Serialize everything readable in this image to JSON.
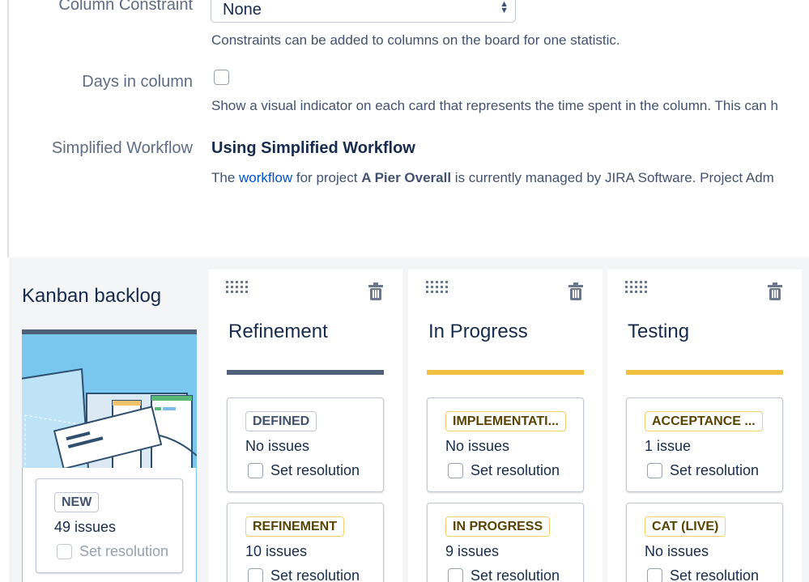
{
  "settings": {
    "column_constraint": {
      "label": "Column Constraint",
      "value": "None",
      "description": "Constraints can be added to columns on the board for one statistic."
    },
    "days_in_column": {
      "label": "Days in column",
      "checked": false,
      "description": "Show a visual indicator on each card that represents the time spent in the column. This can h"
    },
    "simplified_workflow": {
      "label": "Simplified Workflow",
      "heading": "Using Simplified Workflow",
      "desc_prefix": "The ",
      "desc_link": "workflow",
      "desc_middle": " for project ",
      "desc_project": "A Pier Overall",
      "desc_suffix": " is currently managed by JIRA Software. Project Adm"
    }
  },
  "board": {
    "backlog": {
      "title": "Kanban backlog",
      "statuses": [
        {
          "name": "NEW",
          "issues": "49 issues",
          "resolution_label": "Set resolution"
        }
      ]
    },
    "columns": [
      {
        "title": "Refinement",
        "bar_color": "#505f79",
        "statuses": [
          {
            "name": "DEFINED",
            "style": "blue",
            "issues": "No issues",
            "resolution_label": "Set resolution"
          },
          {
            "name": "REFINEMENT",
            "style": "yellow",
            "issues": "10 issues",
            "resolution_label": "Set resolution"
          }
        ]
      },
      {
        "title": "In Progress",
        "bar_color": "#f0c040",
        "statuses": [
          {
            "name": "IMPLEMENTATI...",
            "style": "yellow",
            "issues": "No issues",
            "resolution_label": "Set resolution"
          },
          {
            "name": "IN PROGRESS",
            "style": "yellow",
            "issues": "9 issues",
            "resolution_label": "Set resolution"
          }
        ]
      },
      {
        "title": "Testing",
        "bar_color": "#f0c040",
        "statuses": [
          {
            "name": "ACCEPTANCE ...",
            "style": "yellow",
            "issues": "1 issue",
            "resolution_label": "Set resolution"
          },
          {
            "name": "CAT (LIVE)",
            "style": "yellow",
            "issues": "No issues",
            "resolution_label": "Set resolution"
          }
        ]
      }
    ]
  },
  "icons": {
    "drag_handle": "drag-handle-icon",
    "delete": "trash-icon",
    "select_arrows": "select-arrows-icon",
    "backlog_illustration": "kanban-board-illustration"
  }
}
